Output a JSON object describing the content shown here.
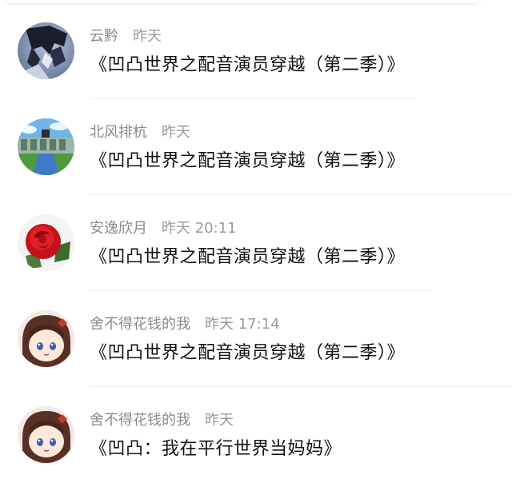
{
  "messages": [
    {
      "sender": "云黔",
      "time": "昨天",
      "text": "《凹凸世界之配音演员穿越（第二季）》",
      "avatar_icon": "dark-anime-character-avatar"
    },
    {
      "sender": "北风排杭",
      "time": "昨天",
      "text": "《凹凸世界之配音演员穿越（第二季）》",
      "avatar_icon": "blue-sky-building-avatar"
    },
    {
      "sender": "安逸欣月",
      "time": "昨天 20:11",
      "text": "《凹凸世界之配音演员穿越（第二季）》",
      "avatar_icon": "red-rose-avatar"
    },
    {
      "sender": "舍不得花钱的我",
      "time": "昨天 17:14",
      "text": "《凹凸世界之配音演员穿越（第二季）》",
      "avatar_icon": "chibi-girl-avatar"
    },
    {
      "sender": "舍不得花钱的我",
      "time": "昨天",
      "text": "《凹凸：我在平行世界当妈妈》",
      "avatar_icon": "chibi-girl-avatar"
    }
  ],
  "colors": {
    "sender_text": "#8a8a8a",
    "message_text": "#111111",
    "divider": "#eeeeee",
    "background": "#ffffff"
  }
}
